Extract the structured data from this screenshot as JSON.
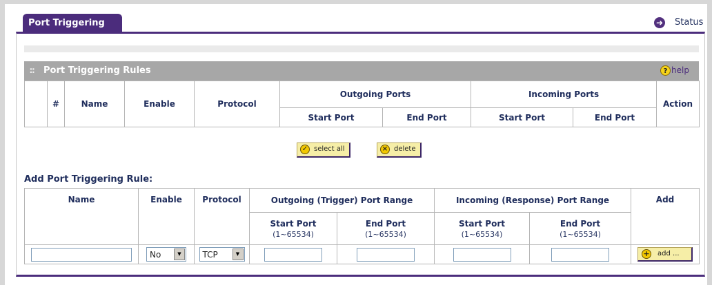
{
  "tab": {
    "label": "Port Triggering"
  },
  "status": {
    "label": "Status",
    "icon": "arrow-right-circle-icon"
  },
  "rules_section": {
    "title": "Port Triggering Rules",
    "help_label": "help",
    "help_icon": "question-circle-icon"
  },
  "rules_table": {
    "headers": {
      "index": "#",
      "name": "Name",
      "enable": "Enable",
      "protocol": "Protocol",
      "outgoing": "Outgoing Ports",
      "incoming": "Incoming Ports",
      "action": "Action",
      "start_port": "Start Port",
      "end_port": "End Port"
    },
    "rows": []
  },
  "buttons": {
    "select_all": "select all",
    "delete": "delete",
    "add": "add ..."
  },
  "add_rule": {
    "title": "Add Port Triggering Rule:",
    "headers": {
      "name": "Name",
      "enable": "Enable",
      "protocol": "Protocol",
      "outgoing": "Outgoing (Trigger) Port Range",
      "incoming": "Incoming (Response) Port Range",
      "add": "Add",
      "start_port": "Start Port",
      "end_port": "End Port",
      "range": "(1~65534)"
    },
    "enable_value": "No",
    "protocol_value": "TCP",
    "name_value": "",
    "out_start_value": "",
    "out_end_value": "",
    "in_start_value": "",
    "in_end_value": ""
  },
  "colors": {
    "accent": "#4b2c7c",
    "section_bar": "#a7a7a7",
    "button": "#f6eea7"
  }
}
